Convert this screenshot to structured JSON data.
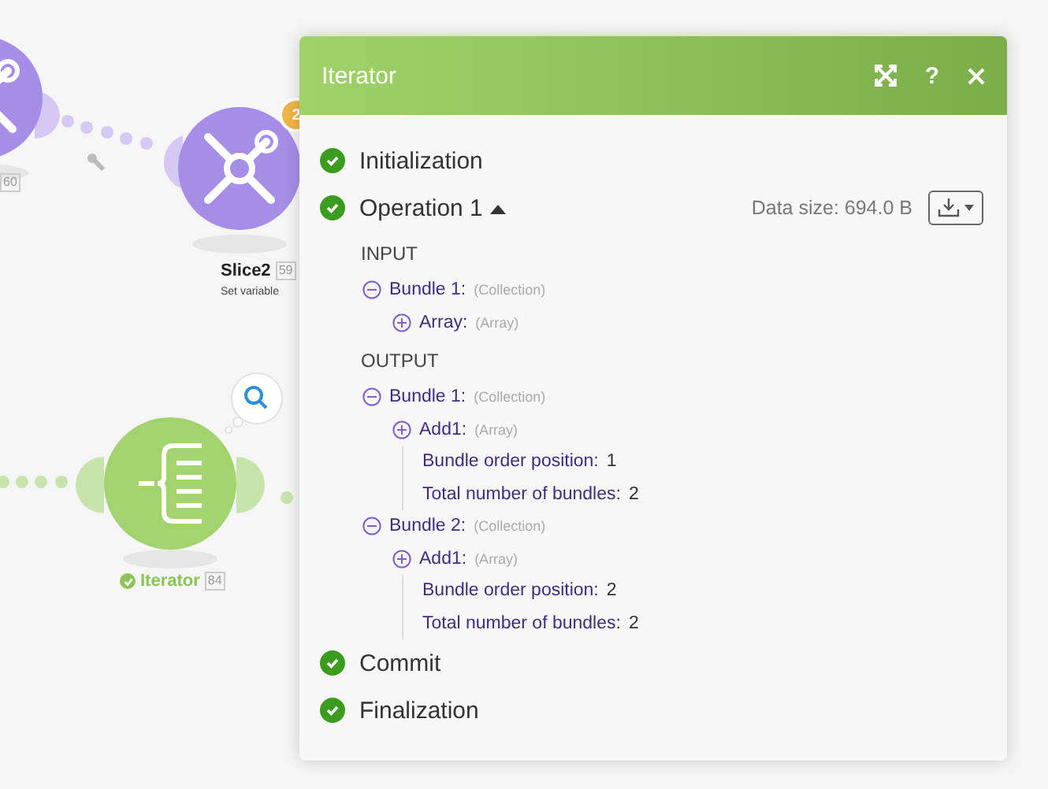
{
  "canvas": {
    "nodes": [
      {
        "kind": "tools",
        "number": "60"
      },
      {
        "kind": "tools",
        "name": "Slice2",
        "number": "59",
        "subtitle": "Set variable",
        "badge": "2"
      },
      {
        "kind": "iterator",
        "name": "Iterator",
        "number": "84",
        "ok": true
      }
    ]
  },
  "panel": {
    "title": "Iterator",
    "help": "?",
    "steps": [
      {
        "label": "Initialization",
        "ok": true
      },
      {
        "label": "Operation 1",
        "ok": true,
        "expanded": true,
        "data_size": "Data size: 694.0 B",
        "sections": [
          {
            "label": "INPUT",
            "items": [
              {
                "key": "Bundle 1:",
                "type": "(Collection)",
                "expanded": true,
                "children": [
                  {
                    "key": "Array:",
                    "type": "(Array)",
                    "expanded": false
                  }
                ]
              }
            ]
          },
          {
            "label": "OUTPUT",
            "items": [
              {
                "key": "Bundle 1:",
                "type": "(Collection)",
                "expanded": true,
                "children": [
                  {
                    "key": "Add1:",
                    "type": "(Array)",
                    "expanded": false
                  },
                  {
                    "key": "Bundle order position:",
                    "value": "1"
                  },
                  {
                    "key": "Total number of bundles:",
                    "value": "2"
                  }
                ]
              },
              {
                "key": "Bundle 2:",
                "type": "(Collection)",
                "expanded": true,
                "children": [
                  {
                    "key": "Add1:",
                    "type": "(Array)",
                    "expanded": false
                  },
                  {
                    "key": "Bundle order position:",
                    "value": "2"
                  },
                  {
                    "key": "Total number of bundles:",
                    "value": "2"
                  }
                ]
              }
            ]
          }
        ]
      },
      {
        "label": "Commit",
        "ok": true
      },
      {
        "label": "Finalization",
        "ok": true
      }
    ]
  }
}
